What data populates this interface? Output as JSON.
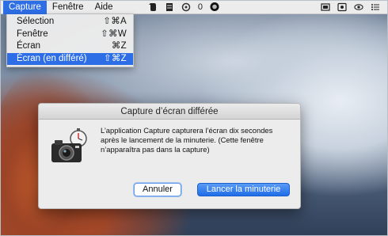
{
  "menubar": {
    "menus": [
      "Capture",
      "Fenêtre",
      "Aide"
    ],
    "active_menu": "Capture",
    "status_counter": "0"
  },
  "dropdown": {
    "items": [
      {
        "label": "Sélection",
        "shortcut": "⇧⌘A"
      },
      {
        "label": "Fenêtre",
        "shortcut": "⇧⌘W"
      },
      {
        "label": "Écran",
        "shortcut": "⌘Z"
      },
      {
        "label": "Écran (en différé)",
        "shortcut": "⇧⌘Z"
      }
    ],
    "highlighted_index": 3
  },
  "dialog": {
    "title": "Capture d’écran différée",
    "line1": "L’application Capture capturera l’écran dix secondes",
    "line2": "après le lancement de la minuterie. (Cette fenêtre",
    "line3": "n’apparaîtra pas dans la capture)",
    "cancel_label": "Annuler",
    "start_label": "Lancer la minuterie"
  },
  "colors": {
    "accent": "#2d6ee6",
    "menubar_bg": "#ececec",
    "dialog_bg": "#ececec"
  }
}
